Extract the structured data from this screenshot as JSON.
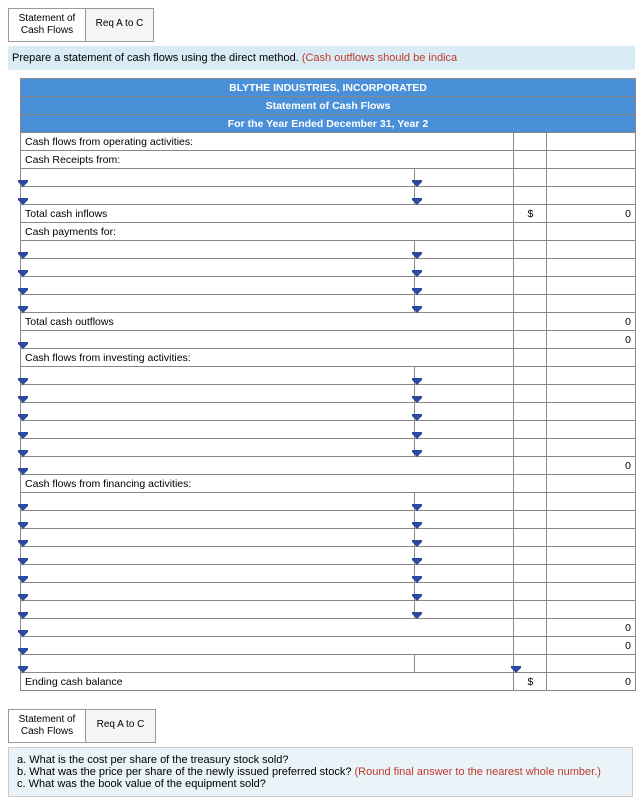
{
  "tabs": {
    "t1": "Statement of\nCash Flows",
    "t2": "Req A to C"
  },
  "instruction": {
    "black": "Prepare a statement of cash flows using the direct method. ",
    "red": "(Cash outflows should be indica"
  },
  "header": {
    "company": "BLYTHE INDUSTRIES, INCORPORATED",
    "title": "Statement of Cash Flows",
    "period": "For the Year Ended December 31, Year 2"
  },
  "rows": {
    "op_head": "Cash flows from operating activities:",
    "receipts": "Cash Receipts from:",
    "tot_in": "Total cash inflows",
    "pay_for": "Cash payments for:",
    "tot_out": "Total cash outflows",
    "inv_head": "Cash flows from investing activities:",
    "fin_head": "Cash flows from financing activities:",
    "ending": "Ending cash balance"
  },
  "sym_dollar": "$",
  "zero": "0",
  "tabs2": {
    "t1": "Statement of\nCash Flows",
    "t2": "Req A to C"
  },
  "questions": {
    "a": "a. What is the cost per share of the treasury stock sold?",
    "b_black": "b. What was the price per share of the newly issued preferred stock? ",
    "b_red": "(Round final answer to the nearest whole number.)",
    "c": "c. What was the book value of the equipment sold?"
  }
}
